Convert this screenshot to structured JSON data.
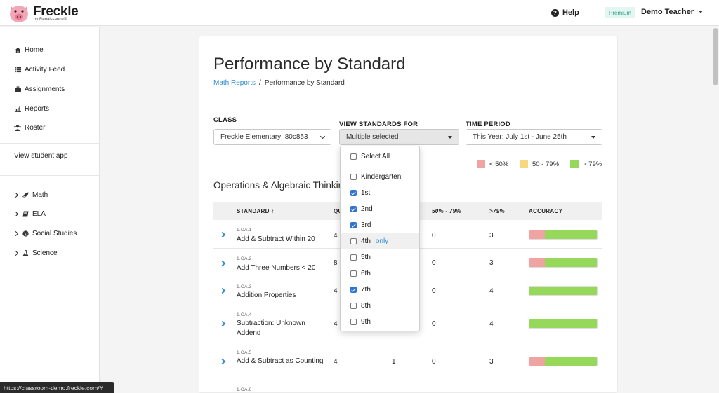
{
  "app": {
    "brand": "Freckle",
    "byline": "by Renaissance®",
    "help_label": "Help",
    "premium_badge": "Premium",
    "user_name": "Demo Teacher"
  },
  "sidebar": {
    "items": [
      {
        "label": "Home",
        "icon": "home-icon"
      },
      {
        "label": "Activity Feed",
        "icon": "list-icon"
      },
      {
        "label": "Assignments",
        "icon": "briefcase-icon"
      },
      {
        "label": "Reports",
        "icon": "bar-chart-icon"
      },
      {
        "label": "Roster",
        "icon": "users-icon"
      }
    ],
    "view_student_app": "View student app",
    "subjects": [
      {
        "label": "Math",
        "icon": "rocket-icon"
      },
      {
        "label": "ELA",
        "icon": "book-icon"
      },
      {
        "label": "Social Studies",
        "icon": "globe-icon"
      },
      {
        "label": "Science",
        "icon": "flask-icon"
      }
    ]
  },
  "page": {
    "title": "Performance by Standard",
    "breadcrumb": {
      "parent": "Math Reports",
      "separator": "/",
      "current": "Performance by Standard"
    }
  },
  "filters": {
    "class_label": "CLASS",
    "class_value": "Freckle Elementary: 80c853",
    "standards_label": "VIEW STANDARDS FOR",
    "standards_value": "Multiple selected",
    "time_label": "TIME PERIOD",
    "time_value": "This Year: July 1st - June 25th"
  },
  "legend": [
    {
      "label": "< 50%",
      "color": "#f0a3a3"
    },
    {
      "label": "50 - 79%",
      "color": "#f7d77f"
    },
    {
      "label": "> 79%",
      "color": "#95d85a"
    }
  ],
  "section_title": "Operations & Algebraic Thinking",
  "table": {
    "headers": {
      "standard": "STANDARD",
      "standard_sort_icon": "↑",
      "questions": "QUESTIONS",
      "col50": "50% - 79%",
      "col79": ">79%",
      "accuracy": "ACCURACY"
    },
    "rows": [
      {
        "code": "1.OA.1",
        "name": "Add & Subtract Within 20",
        "questions": "4",
        "below": "",
        "mid": "0",
        "high": "3",
        "red_pct": 23
      },
      {
        "code": "1.OA.2",
        "name": "Add Three Numbers < 20",
        "questions": "8",
        "below": "",
        "mid": "0",
        "high": "3",
        "red_pct": 23
      },
      {
        "code": "1.OA.3",
        "name": "Addition Properties",
        "questions": "4",
        "below": "",
        "mid": "0",
        "high": "4",
        "red_pct": 0
      },
      {
        "code": "1.OA.4",
        "name": "Subtraction: Unknown Addend",
        "questions": "4",
        "below": "",
        "mid": "0",
        "high": "4",
        "red_pct": 0
      },
      {
        "code": "1.OA.5",
        "name": "Add & Subtract as Counting",
        "questions": "4",
        "below": "1",
        "mid": "0",
        "high": "3",
        "red_pct": 23
      },
      {
        "code": "1.OA.6",
        "name": "",
        "questions": "",
        "below": "",
        "mid": "",
        "high": "",
        "red_pct": 0
      }
    ]
  },
  "dropdown": {
    "select_all": "Select All",
    "only_label": "only",
    "options": [
      {
        "label": "Kindergarten",
        "checked": false
      },
      {
        "label": "1st",
        "checked": true
      },
      {
        "label": "2nd",
        "checked": true
      },
      {
        "label": "3rd",
        "checked": true
      },
      {
        "label": "4th",
        "checked": false
      },
      {
        "label": "5th",
        "checked": false
      },
      {
        "label": "6th",
        "checked": false
      },
      {
        "label": "7th",
        "checked": true
      },
      {
        "label": "8th",
        "checked": false
      },
      {
        "label": "9th",
        "checked": false
      }
    ]
  },
  "status_url": "https://classroom-demo.freckle.com/#"
}
